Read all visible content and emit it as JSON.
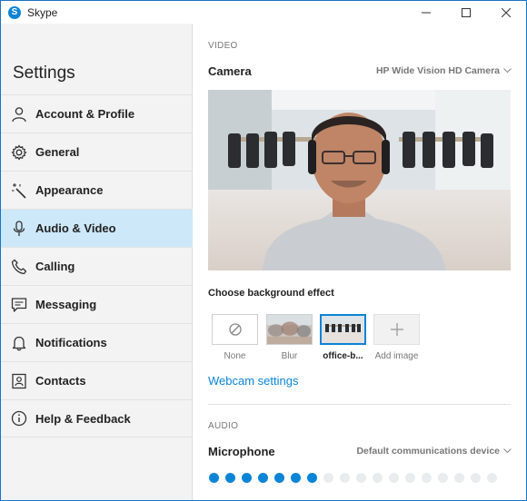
{
  "window": {
    "title": "Skype",
    "app_logo_letter": "S"
  },
  "sidebar": {
    "title": "Settings",
    "items": [
      {
        "label": "Account & Profile",
        "icon": "person-icon"
      },
      {
        "label": "General",
        "icon": "gear-icon"
      },
      {
        "label": "Appearance",
        "icon": "magic-wand-icon"
      },
      {
        "label": "Audio & Video",
        "icon": "microphone-icon",
        "active": true
      },
      {
        "label": "Calling",
        "icon": "phone-icon"
      },
      {
        "label": "Messaging",
        "icon": "chat-icon"
      },
      {
        "label": "Notifications",
        "icon": "bell-icon"
      },
      {
        "label": "Contacts",
        "icon": "contact-card-icon"
      },
      {
        "label": "Help & Feedback",
        "icon": "info-icon"
      }
    ]
  },
  "video": {
    "section_label": "VIDEO",
    "camera_label": "Camera",
    "camera_device": "HP Wide Vision HD Camera",
    "background_title": "Choose background effect",
    "effects": [
      {
        "label": "None"
      },
      {
        "label": "Blur"
      },
      {
        "label": "office-b...",
        "selected": true
      },
      {
        "label": "Add image"
      }
    ],
    "webcam_link": "Webcam settings"
  },
  "audio": {
    "section_label": "AUDIO",
    "microphone_label": "Microphone",
    "microphone_device": "Default communications device",
    "level_dots_total": 18,
    "level_dots_active": 7
  },
  "colors": {
    "accent": "#0a84d6",
    "active_nav": "#cde8f8",
    "sidebar_bg": "#f3f3f3"
  }
}
